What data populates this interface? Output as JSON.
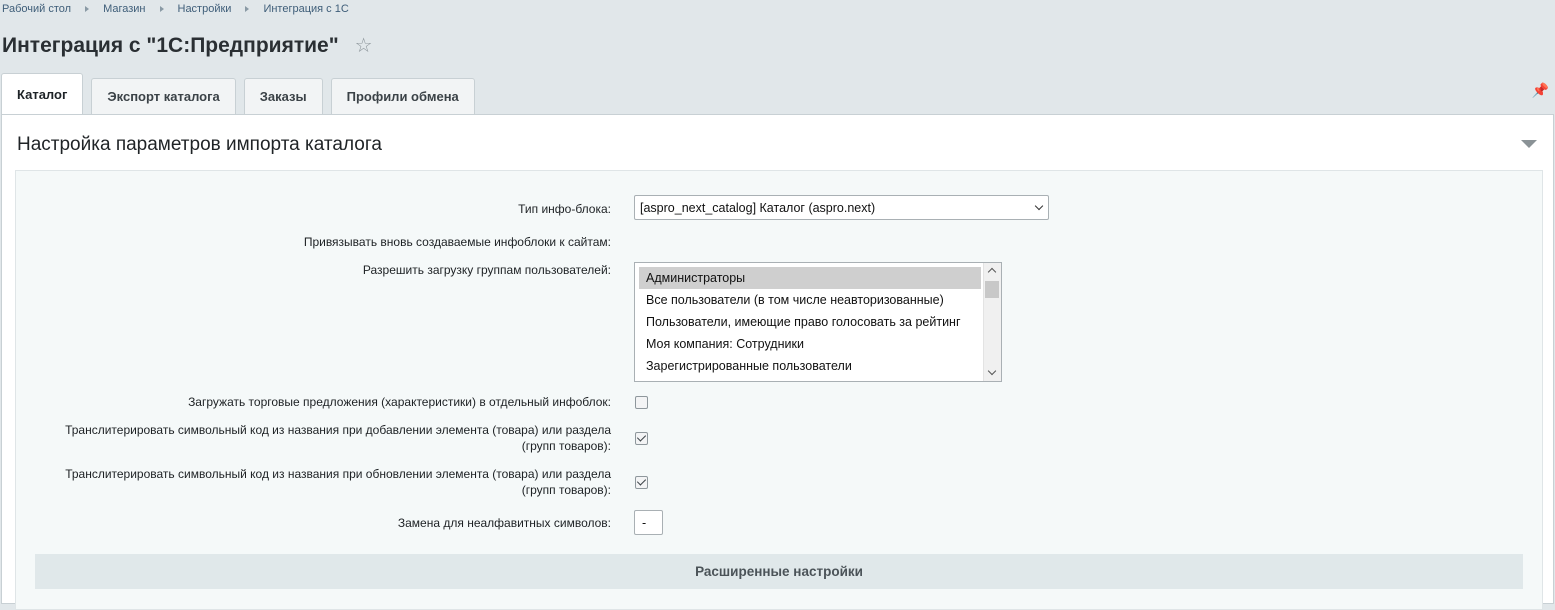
{
  "breadcrumb": [
    "Рабочий стол",
    "Магазин",
    "Настройки",
    "Интеграция с 1С"
  ],
  "page": {
    "title": "Интеграция с \"1С:Предприятие\""
  },
  "icons": {
    "favorite": "star-icon",
    "pin": "pin-icon",
    "collapse": "triangle-down-icon"
  },
  "tabs": [
    {
      "label": "Каталог",
      "active": true
    },
    {
      "label": "Экспорт каталога",
      "active": false
    },
    {
      "label": "Заказы",
      "active": false
    },
    {
      "label": "Профили обмена",
      "active": false
    }
  ],
  "section": {
    "title": "Настройка параметров импорта каталога"
  },
  "form": {
    "iblock_type_label": "Тип инфо-блока:",
    "iblock_type_value": "[aspro_next_catalog] Каталог (aspro.next)",
    "bind_sites_label": "Привязывать вновь создаваемые инфоблоки к сайтам:",
    "groups_label": "Разрешить загрузку группам пользователей:",
    "groups_options": [
      "Администраторы",
      "Все пользователи (в том числе неавторизованные)",
      "Пользователи, имеющие право голосовать за рейтинг",
      "Моя компания: Сотрудники",
      "Зарегистрированные пользователи"
    ],
    "groups_selected": "Администраторы",
    "offers_label": "Загружать торговые предложения (характеристики) в отдельный инфоблок:",
    "offers_checked": false,
    "translit_add_label_1": "Транслитерировать символьный код из названия при добавлении элемента (товара) или раздела",
    "translit_add_label_2": "(групп товаров):",
    "translit_add_checked": true,
    "translit_update_label_1": "Транслитерировать символьный код из названия при обновлении элемента (товара) или раздела",
    "translit_update_label_2": "(групп товаров):",
    "translit_update_checked": true,
    "replace_label": "Замена для неалфавитных символов:",
    "replace_value": "-",
    "advanced_label": "Расширенные настройки"
  }
}
